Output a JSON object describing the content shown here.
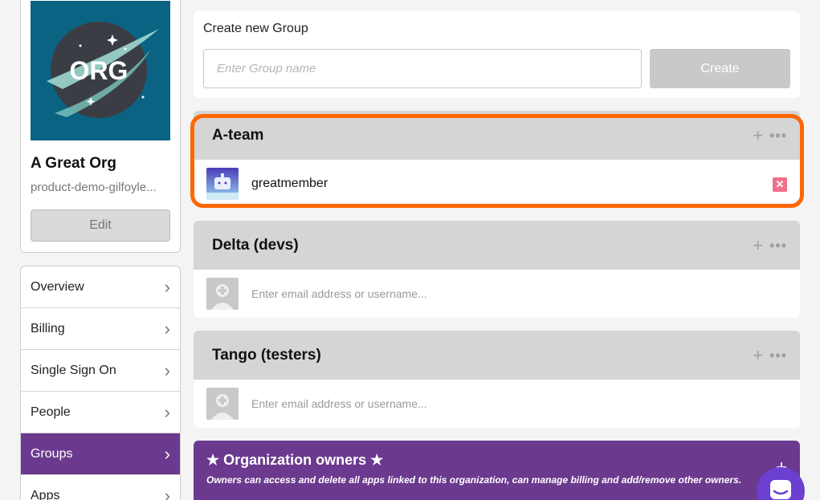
{
  "org": {
    "name": "A Great Org",
    "slug": "product-demo-gilfoyle...",
    "logo_text": "ORG",
    "edit_label": "Edit"
  },
  "nav": {
    "items": [
      {
        "label": "Overview",
        "active": false
      },
      {
        "label": "Billing",
        "active": false
      },
      {
        "label": "Single Sign On",
        "active": false
      },
      {
        "label": "People",
        "active": false
      },
      {
        "label": "Groups",
        "active": true
      },
      {
        "label": "Apps",
        "active": false
      }
    ]
  },
  "create_group": {
    "title": "Create new Group",
    "placeholder": "Enter Group name",
    "button_label": "Create"
  },
  "groups": [
    {
      "name": "A-team",
      "members": [
        {
          "username": "greatmember"
        }
      ],
      "highlighted": true
    },
    {
      "name": "Delta (devs)",
      "members": [],
      "email_placeholder": "Enter email address or username..."
    },
    {
      "name": "Tango (testers)",
      "members": [],
      "email_placeholder": "Enter email address or username..."
    }
  ],
  "owners": {
    "title": "★ Organization owners ★",
    "description": "Owners can access and delete all apps linked to this organization, can manage billing and add/remove other owners."
  },
  "icons": {
    "add": "plus-icon",
    "more": "more-icon",
    "remove": "close-icon",
    "nav": "chevron-right-icon",
    "chat": "chat-icon"
  },
  "colors": {
    "accent_purple": "#6b3a8e",
    "highlight_orange": "#ff6600",
    "remove_pink": "#f06f8c",
    "logo_bg": "#0b6383"
  }
}
